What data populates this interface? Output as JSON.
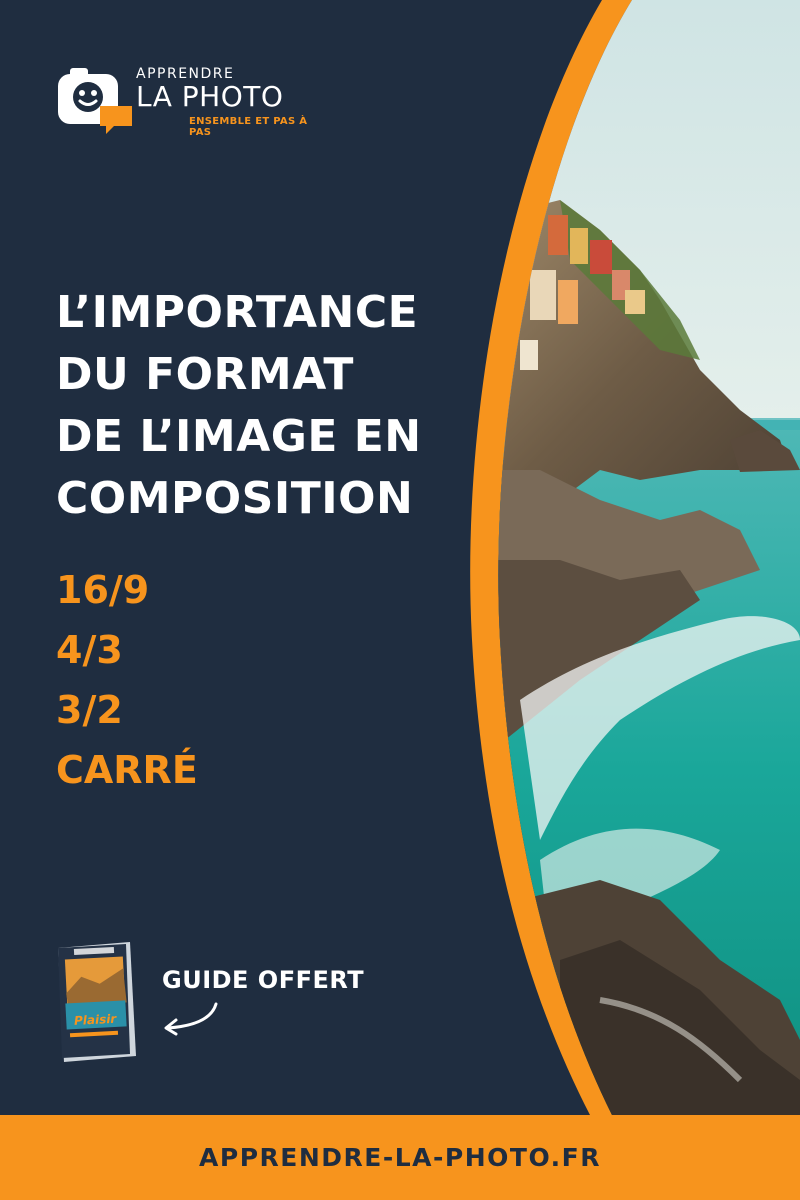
{
  "logo": {
    "line1": "APPRENDRE",
    "line2": "LA PHOTO",
    "tagline": "ENSEMBLE ET PAS À PAS"
  },
  "headline": {
    "lines": [
      "L’IMPORTANCE",
      "DU FORMAT",
      "DE L’IMAGE EN",
      "COMPOSITION"
    ]
  },
  "formats": [
    "16/9",
    "4/3",
    "3/2",
    "CARRÉ"
  ],
  "guide": {
    "label": "GUIDE OFFERT",
    "book_title": "Plaisir"
  },
  "footer": {
    "url": "APPRENDRE-LA-PHOTO.FR"
  },
  "colors": {
    "background": "#1f2d40",
    "accent": "#f7941d",
    "text": "#ffffff",
    "sea": "#1aa79a"
  }
}
